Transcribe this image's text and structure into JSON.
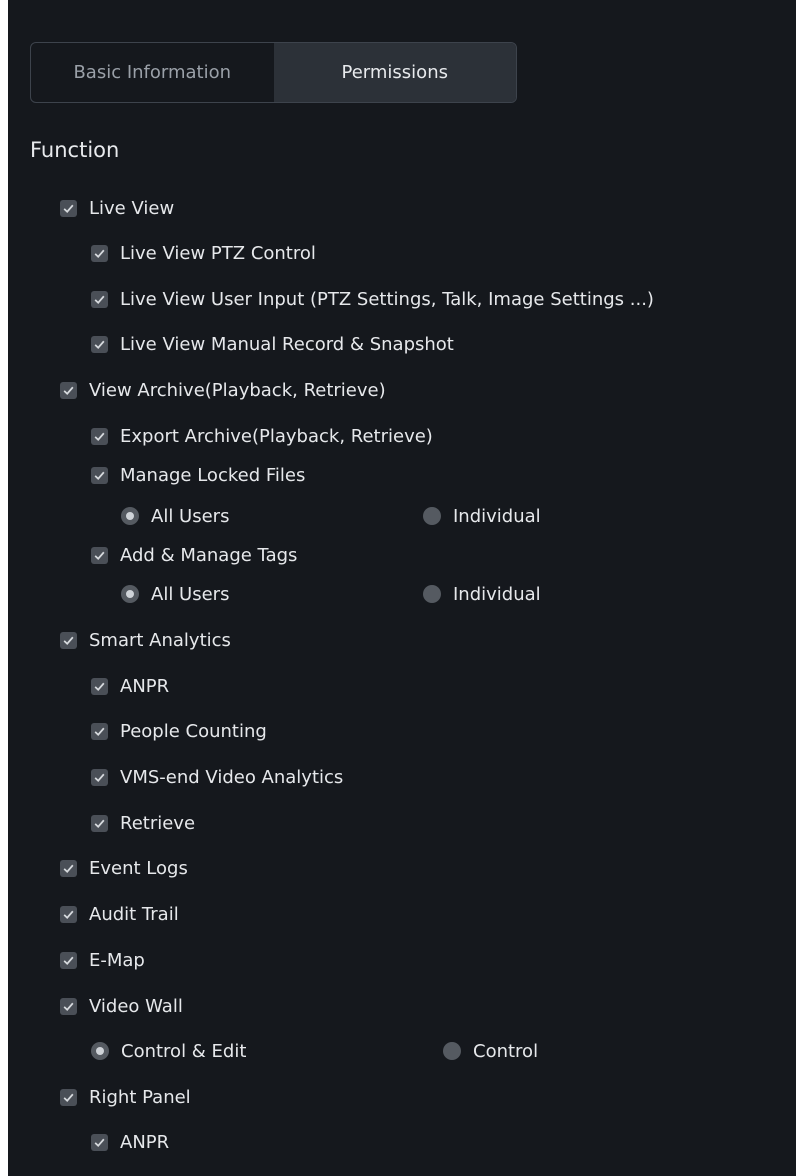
{
  "tabs": [
    {
      "label": "Basic Information",
      "active": false
    },
    {
      "label": "Permissions",
      "active": true
    }
  ],
  "section_title": "Function",
  "items": {
    "live_view": "Live View",
    "live_view_ptz": "Live View PTZ Control",
    "live_view_user_input": "Live View User Input (PTZ Settings, Talk, Image Settings ...)",
    "live_view_manual_record": "Live View Manual Record & Snapshot",
    "view_archive": "View Archive(Playback, Retrieve)",
    "export_archive": "Export Archive(Playback, Retrieve)",
    "manage_locked_files": "Manage Locked Files",
    "locked_all_users": "All Users",
    "locked_individual": "Individual",
    "add_manage_tags": "Add & Manage Tags",
    "tags_all_users": "All Users",
    "tags_individual": "Individual",
    "smart_analytics": "Smart Analytics",
    "anpr": "ANPR",
    "people_counting": "People Counting",
    "vms_analytics": "VMS-end Video Analytics",
    "retrieve": "Retrieve",
    "event_logs": "Event Logs",
    "audit_trail": "Audit Trail",
    "e_map": "E-Map",
    "video_wall": "Video Wall",
    "vw_control_edit": "Control & Edit",
    "vw_control": "Control",
    "right_panel": "Right Panel",
    "rp_anpr": "ANPR"
  },
  "colors": {
    "background": "#15181d",
    "active_tab": "#2c3138",
    "checkbox": "#4a4f57",
    "text": "#e6e8eb"
  }
}
